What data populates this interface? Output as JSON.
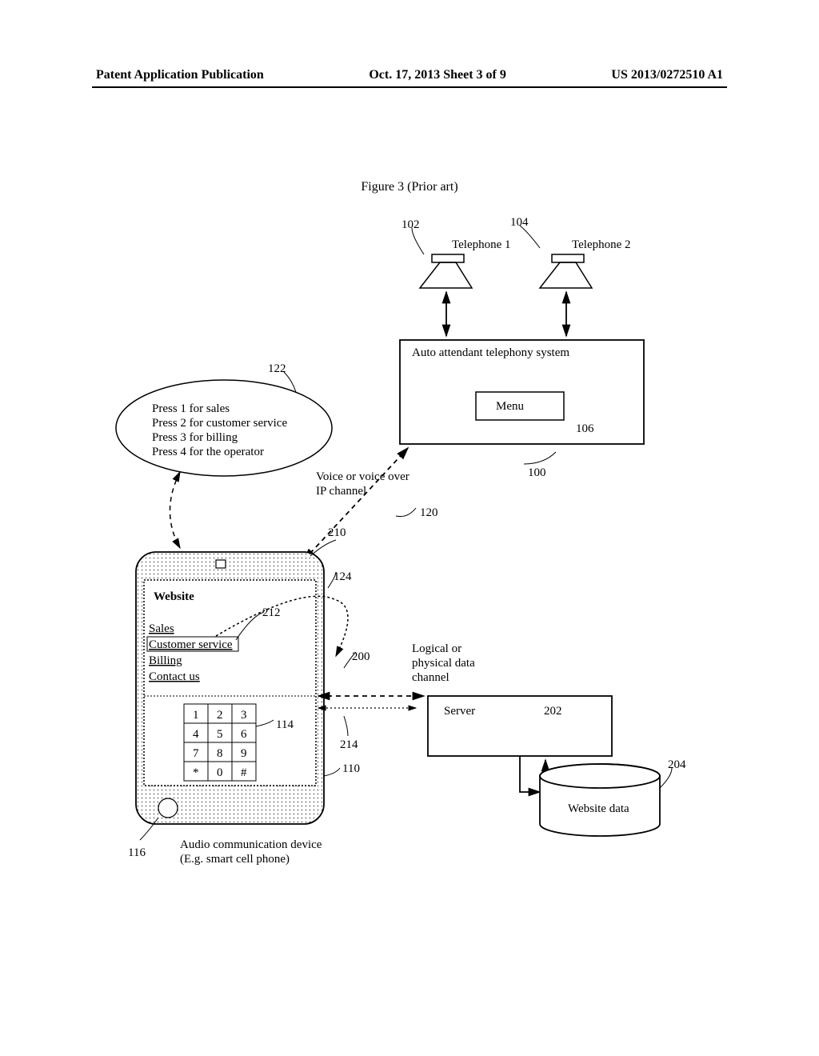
{
  "header": {
    "left": "Patent Application Publication",
    "center": "Oct. 17, 2013  Sheet 3 of 9",
    "right": "US 2013/0272510 A1"
  },
  "figure_title": "Figure 3 (Prior art)",
  "labels": {
    "telephone1": "Telephone 1",
    "telephone2": "Telephone 2",
    "auto_attendant": "Auto attendant telephony system",
    "menu": "Menu",
    "voice_channel_1": "Voice or voice over",
    "voice_channel_2": "IP channel",
    "data_channel_1": "Logical or",
    "data_channel_2": "physical data",
    "data_channel_3": "channel",
    "server": "Server",
    "website_data": "Website data",
    "device_line1": "Audio communication device",
    "device_line2": "(E.g. smart cell phone)"
  },
  "bubble": {
    "line1": "Press 1 for sales",
    "line2": "Press 2 for customer service",
    "line3": "Press 3 for billing",
    "line4": "Press 4 for the operator"
  },
  "website": {
    "title": "Website",
    "item1": "Sales",
    "item2": "Customer service",
    "item3": "Billing",
    "item4": "Contact us"
  },
  "keypad": [
    [
      "1",
      "2",
      "3"
    ],
    [
      "4",
      "5",
      "6"
    ],
    [
      "7",
      "8",
      "9"
    ],
    [
      "*",
      "0",
      "#"
    ]
  ],
  "refs": {
    "r100": "100",
    "r102": "102",
    "r104": "104",
    "r106": "106",
    "r110": "110",
    "r114": "114",
    "r116": "116",
    "r120": "120",
    "r122": "122",
    "r124": "124",
    "r200": "200",
    "r202": "202",
    "r204": "204",
    "r210": "210",
    "r212": "212",
    "r214": "214"
  }
}
